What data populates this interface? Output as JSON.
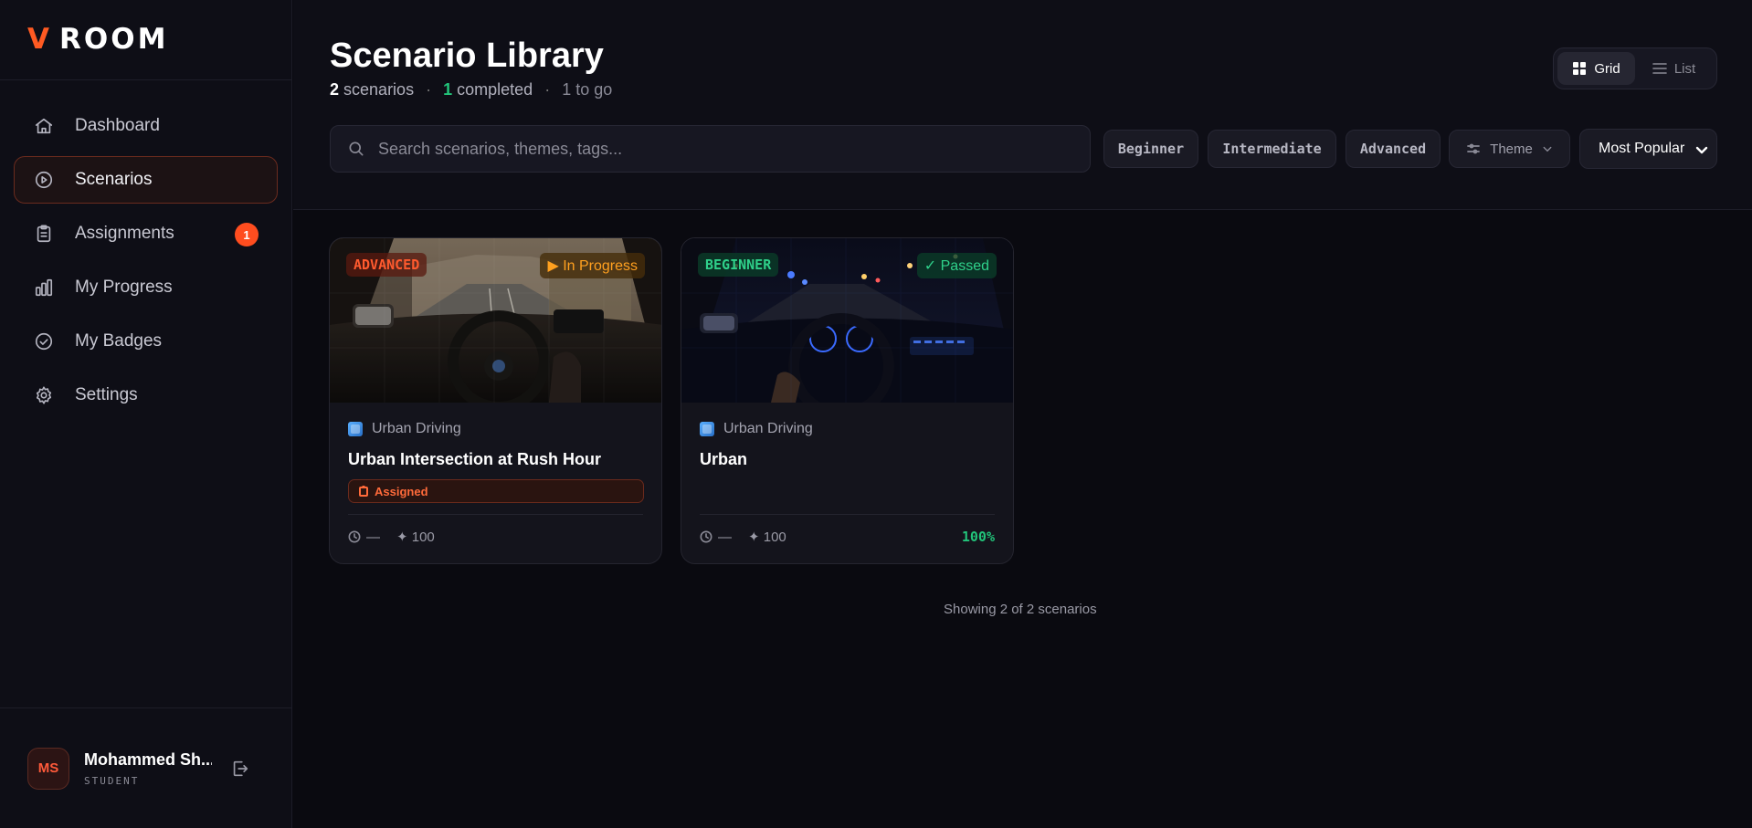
{
  "app": {
    "logo_v": "V",
    "logo_word": "ROOM"
  },
  "nav": [
    {
      "label": "Dashboard",
      "icon": "home-icon"
    },
    {
      "label": "Scenarios",
      "icon": "play-circle-icon",
      "active": true
    },
    {
      "label": "Assignments",
      "icon": "clipboard-icon",
      "badge": "1"
    },
    {
      "label": "My Progress",
      "icon": "bar-chart-icon"
    },
    {
      "label": "My Badges",
      "icon": "check-badge-icon"
    },
    {
      "label": "Settings",
      "icon": "gear-icon"
    }
  ],
  "user": {
    "initials": "MS",
    "name": "Mohammed Sh...",
    "role": "STUDENT"
  },
  "header": {
    "title": "Scenario Library",
    "count_num": "2",
    "count_word": "scenarios",
    "completed_num": "1",
    "completed_word": "completed",
    "to_go": "1 to go"
  },
  "view_toggle": {
    "grid": "Grid",
    "list": "List",
    "active": "grid"
  },
  "search": {
    "placeholder": "Search scenarios, themes, tags...",
    "value": ""
  },
  "filters": {
    "beginner": "Beginner",
    "intermediate": "Intermediate",
    "advanced": "Advanced",
    "theme": "Theme"
  },
  "sort": {
    "selected": "Most Popular"
  },
  "cards": [
    {
      "level": "ADVANCED",
      "status": "▶ In Progress",
      "theme": "Urban Driving",
      "title": "Urban Intersection at Rush Hour",
      "assigned": "Assigned",
      "duration": "—",
      "points": "✦ 100",
      "score": ""
    },
    {
      "level": "BEGINNER",
      "status": "✓ Passed",
      "theme": "Urban Driving",
      "title": "Urban",
      "assigned": "",
      "duration": "—",
      "points": "✦ 100",
      "score": "100%"
    }
  ],
  "footer": {
    "showing": "Showing 2 of 2 scenarios"
  },
  "colors": {
    "accent": "#ff5a22",
    "success": "#22c47a",
    "warning": "#ffa01f",
    "background": "#0a0a10"
  }
}
